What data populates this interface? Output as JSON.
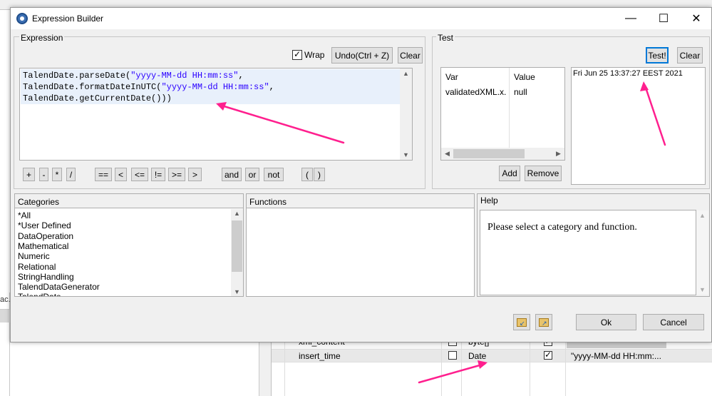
{
  "dialog": {
    "title": "Expression Builder",
    "window_controls": {
      "minimize": "—",
      "maximize": "☐",
      "close": "✕"
    }
  },
  "expression": {
    "group_label": "Expression",
    "wrap_label": "Wrap",
    "wrap_checked": true,
    "undo_label": "Undo(Ctrl + Z)",
    "clear_label": "Clear",
    "code_lines": [
      {
        "pre": "TalendDate.parseDate(",
        "str": "\"yyyy-MM-dd HH:mm:ss\"",
        "post": ","
      },
      {
        "pre": "TalendDate.formatDateInUTC(",
        "str": "\"yyyy-MM-dd HH:mm:ss\"",
        "post": ","
      },
      {
        "pre": "TalendDate.getCurrentDate()))",
        "str": "",
        "post": ""
      }
    ],
    "operators": [
      "+",
      "-",
      "*",
      "/",
      "==",
      "<",
      "<=",
      "!=",
      ">=",
      ">",
      "and",
      "or",
      "not",
      "(",
      ")"
    ]
  },
  "test": {
    "group_label": "Test",
    "test_button": "Test!",
    "clear_button": "Clear",
    "columns": [
      "Var",
      "Value"
    ],
    "rows": [
      {
        "var": "validatedXML.x...",
        "value": "null"
      }
    ],
    "add_button": "Add",
    "remove_button": "Remove",
    "result": "Fri Jun 25 13:37:27 EEST 2021"
  },
  "categories": {
    "header": "Categories",
    "items": [
      "*All",
      "*User Defined",
      "DataOperation",
      "Mathematical",
      "Numeric",
      "Relational",
      "StringHandling",
      "TalendDataGenerator",
      "TalendDate"
    ]
  },
  "functions": {
    "header": "Functions"
  },
  "help": {
    "header": "Help",
    "text": "Please select a category and function."
  },
  "footer": {
    "ok_label": "Ok",
    "cancel_label": "Cancel",
    "icon_left": "import-icon",
    "icon_right": "export-icon"
  },
  "background": {
    "left_stub": "ac...",
    "rows": [
      {
        "name": "xml_content",
        "type": "byte[]",
        "key_checked": false,
        "nullable_checked": true,
        "pattern": ""
      },
      {
        "name": "insert_time",
        "type": "Date",
        "key_checked": false,
        "nullable_checked": true,
        "pattern": "\"yyyy-MM-dd HH:mm:..."
      }
    ]
  },
  "colors": {
    "annotation_arrow": "#ff1f8e",
    "code_string": "#2a00ff",
    "focus": "#0078d7"
  }
}
